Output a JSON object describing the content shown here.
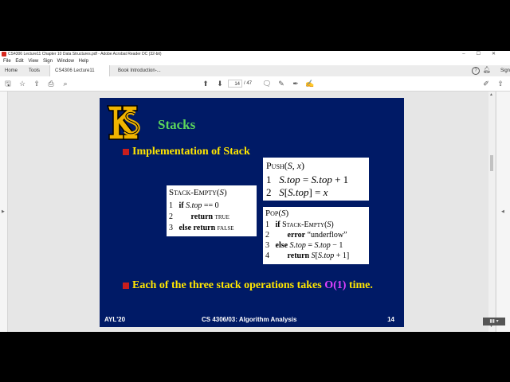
{
  "window": {
    "title": "CS4306 Lecture11 Chapter 10 Data Structures.pdf - Adobe Acrobat Reader DC (32-bit)",
    "controls": [
      "–",
      "☐",
      "✕"
    ]
  },
  "menu": [
    "File",
    "Edit",
    "View",
    "Sign",
    "Window",
    "Help"
  ],
  "tabs": {
    "home": "Home",
    "tools": "Tools",
    "doc1": "CS4306 Lecture11 ...",
    "doc1_close": "×",
    "doc2": "Book Introduction-..."
  },
  "top_right": {
    "help": "?",
    "sign_in": "Sign"
  },
  "toolbar": {
    "page_current": "14",
    "page_total": "/ 47"
  },
  "slide": {
    "title": "Stacks",
    "bullet1": "Implementation of Stack",
    "bullet2_pre": "Each of the three stack operations takes ",
    "bullet2_o": "O(1)",
    "bullet2_post": " time.",
    "push": {
      "header": "Push(S, x)",
      "lines": [
        {
          "n": "1",
          "code": "S.top = S.top + 1"
        },
        {
          "n": "2",
          "code": "S[S.top] = x"
        }
      ]
    },
    "stack_empty": {
      "header": "Stack-Empty(S)",
      "lines": [
        {
          "n": "1",
          "code": "if S.top == 0"
        },
        {
          "n": "2",
          "code": "return TRUE"
        },
        {
          "n": "3",
          "code": "else return FALSE"
        }
      ]
    },
    "pop": {
      "header": "Pop(S)",
      "lines": [
        {
          "n": "1",
          "code": "if Stack-Empty(S)"
        },
        {
          "n": "2",
          "code": "error “underflow”"
        },
        {
          "n": "3",
          "code": "else S.top = S.top − 1"
        },
        {
          "n": "4",
          "code": "return S[S.top + 1]"
        }
      ]
    },
    "footer_left": "AYL'20",
    "footer_center": "CS 4306/03: Algorithm Analysis",
    "footer_right": "14"
  },
  "colors": {
    "slide_bg": "#001a66",
    "title_green": "#5cd65c",
    "bullet_yellow": "#ffe600",
    "bullet_red": "#c81e1e",
    "o_magenta": "#e040ff",
    "logo_gold": "#f0b400"
  }
}
